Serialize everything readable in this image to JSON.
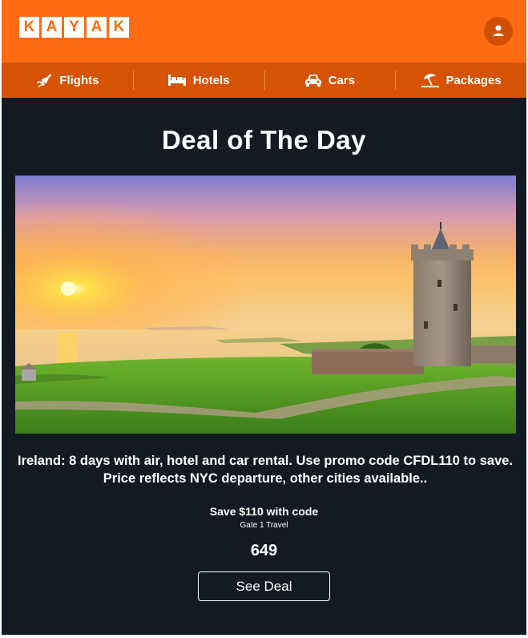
{
  "header": {
    "logo_letters": [
      "K",
      "A",
      "Y",
      "A",
      "K"
    ],
    "avatar_icon": "user-icon",
    "brand_color": "#ff6b12"
  },
  "nav": {
    "items": [
      {
        "label": "Flights",
        "icon": "airplane-icon"
      },
      {
        "label": "Hotels",
        "icon": "bed-icon"
      },
      {
        "label": "Cars",
        "icon": "car-icon"
      },
      {
        "label": "Packages",
        "icon": "beach-umbrella-icon"
      }
    ]
  },
  "deal": {
    "heading": "Deal of The Day",
    "description": "Ireland: 8 days with air, hotel and car rental. Use promo code CFDL110 to save. Price reflects NYC departure, other cities available..",
    "savings": "Save $110 with code",
    "provider": "Gate 1 Travel",
    "price": "649",
    "cta_label": "See Deal"
  }
}
